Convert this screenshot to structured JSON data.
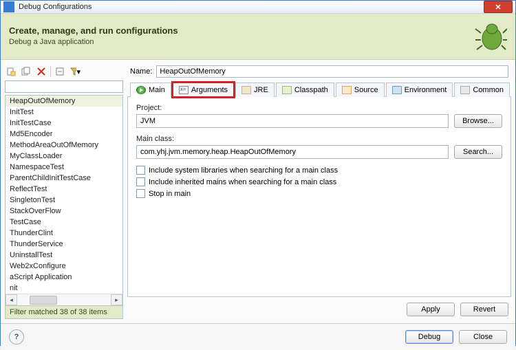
{
  "window": {
    "title": "Debug Configurations"
  },
  "banner": {
    "heading": "Create, manage, and run configurations",
    "sub": "Debug a Java application"
  },
  "toolbar_icons": {
    "new": "new-config-icon",
    "duplicate": "duplicate-icon",
    "delete": "delete-icon",
    "collapse": "collapse-all-icon",
    "filter": "filter-icon"
  },
  "filter": {
    "value": "",
    "placeholder": ""
  },
  "tree": {
    "items": [
      "HeapOutOfMemory",
      "InitTest",
      "InitTestCase",
      "Md5Encoder",
      "MethodAreaOutOfMemory",
      "MyClassLoader",
      "NamespaceTest",
      "ParentChildInitTestCase",
      "ReflectTest",
      "SingletonTest",
      "StackOverFlow",
      "TestCase",
      "ThunderClint",
      "ThunderService",
      "UninstallTest",
      "Web2xConfigure",
      "aScript Application",
      "nit"
    ],
    "selected_index": 0
  },
  "filter_status": "Filter matched 38 of 38 items",
  "name": {
    "label": "Name:",
    "value": "HeapOutOfMemory"
  },
  "tabs": {
    "items": [
      {
        "label": "Main",
        "icon": "run"
      },
      {
        "label": "Arguments",
        "icon": "args"
      },
      {
        "label": "JRE",
        "icon": "jre"
      },
      {
        "label": "Classpath",
        "icon": "cp"
      },
      {
        "label": "Source",
        "icon": "src"
      },
      {
        "label": "Environment",
        "icon": "env"
      },
      {
        "label": "Common",
        "icon": "com"
      }
    ],
    "active_index": 0,
    "highlighted_index": 1
  },
  "main_tab": {
    "project_label": "Project:",
    "project_value": "JVM",
    "browse": "Browse...",
    "mainclass_label": "Main class:",
    "mainclass_value": "com.yhj.jvm.memory.heap.HeapOutOfMemory",
    "search": "Search...",
    "chk1": "Include system libraries when searching for a main class",
    "chk2": "Include inherited mains when searching for a main class",
    "chk3": "Stop in main"
  },
  "buttons": {
    "apply": "Apply",
    "revert": "Revert",
    "debug": "Debug",
    "close": "Close"
  }
}
